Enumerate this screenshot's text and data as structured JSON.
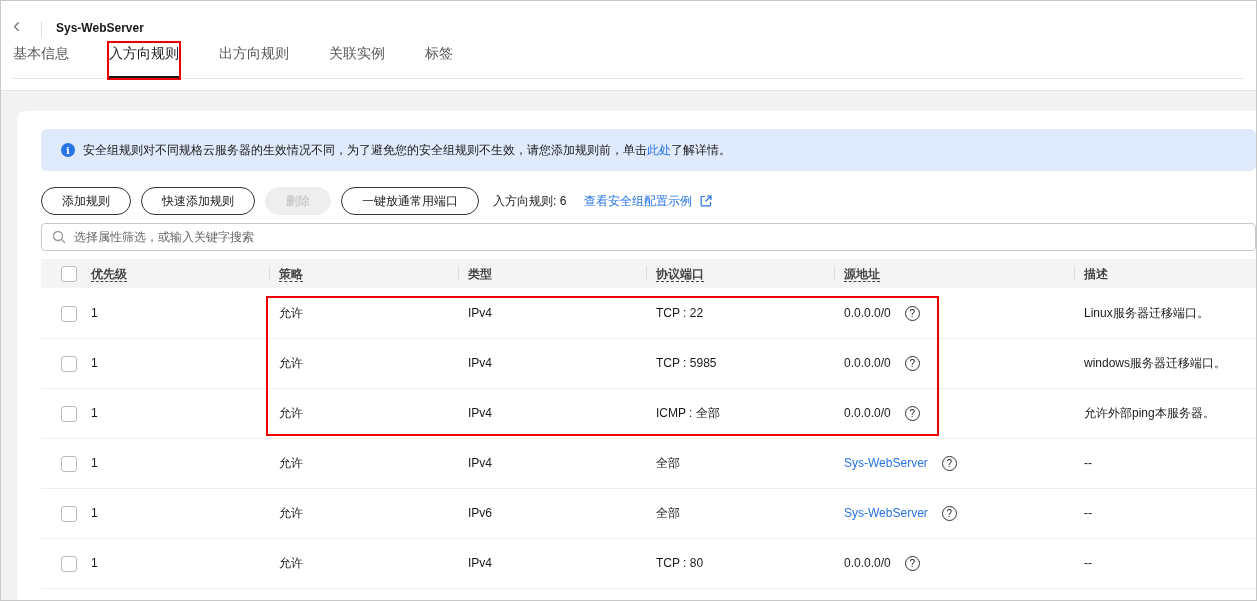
{
  "header": {
    "back": "‹",
    "title": "Sys-WebServer"
  },
  "tabs": [
    {
      "label": "基本信息",
      "selected": false,
      "highlighted": false
    },
    {
      "label": "入方向规则",
      "selected": true,
      "highlighted": true
    },
    {
      "label": "出方向规则",
      "selected": false,
      "highlighted": false
    },
    {
      "label": "关联实例",
      "selected": false,
      "highlighted": false
    },
    {
      "label": "标签",
      "selected": false,
      "highlighted": false
    }
  ],
  "notice": {
    "icon": "i",
    "text": "安全组规则对不同规格云服务器的生效情况不同，为了避免您的安全组规则不生效，请您添加规则前，单击",
    "link": "此处",
    "suffix": "了解详情。"
  },
  "buttons": [
    {
      "label": "添加规则",
      "disabled": false
    },
    {
      "label": "快速添加规则",
      "disabled": false
    },
    {
      "label": "删除",
      "disabled": true
    },
    {
      "label": "一键放通常用端口",
      "disabled": false
    }
  ],
  "rule_count": "入方向规则: 6",
  "example_link": "查看安全组配置示例",
  "search": {
    "placeholder": "选择属性筛选，或输入关键字搜索"
  },
  "table": {
    "select_all": {
      "checked": false
    },
    "columns": [
      {
        "label": "优先级",
        "underlined": true
      },
      {
        "label": "策略",
        "underlined": true
      },
      {
        "label": "类型",
        "underlined": false
      },
      {
        "label": "协议端口",
        "underlined": true
      },
      {
        "label": "源地址",
        "underlined": true
      },
      {
        "label": "描述",
        "underlined": false
      }
    ],
    "rows": [
      {
        "checked": false,
        "highlighted": true,
        "priority": "1",
        "policy": "允许",
        "type": "IPv4",
        "port": "TCP : 22",
        "source": {
          "kind": "address",
          "text": "0.0.0.0/0"
        },
        "help": "?",
        "description": "Linux服务器迁移端口。"
      },
      {
        "checked": false,
        "highlighted": true,
        "priority": "1",
        "policy": "允许",
        "type": "IPv4",
        "port": "TCP : 5985",
        "source": {
          "kind": "address",
          "text": "0.0.0.0/0"
        },
        "help": "?",
        "description": "windows服务器迁移端口。"
      },
      {
        "checked": false,
        "highlighted": true,
        "priority": "1",
        "policy": "允许",
        "type": "IPv4",
        "port": "ICMP : 全部",
        "source": {
          "kind": "address",
          "text": "0.0.0.0/0"
        },
        "help": "?",
        "description": "允许外部ping本服务器。"
      },
      {
        "checked": false,
        "highlighted": false,
        "priority": "1",
        "policy": "允许",
        "type": "IPv4",
        "port": "全部",
        "source": {
          "kind": "link",
          "text": "Sys-WebServer"
        },
        "help": "?",
        "description": "--"
      },
      {
        "checked": false,
        "highlighted": false,
        "priority": "1",
        "policy": "允许",
        "type": "IPv6",
        "port": "全部",
        "source": {
          "kind": "link",
          "text": "Sys-WebServer"
        },
        "help": "?",
        "description": "--"
      },
      {
        "checked": false,
        "highlighted": false,
        "priority": "1",
        "policy": "允许",
        "type": "IPv4",
        "port": "TCP : 80",
        "source": {
          "kind": "address",
          "text": "0.0.0.0/0"
        },
        "help": "?",
        "description": "--"
      }
    ]
  }
}
